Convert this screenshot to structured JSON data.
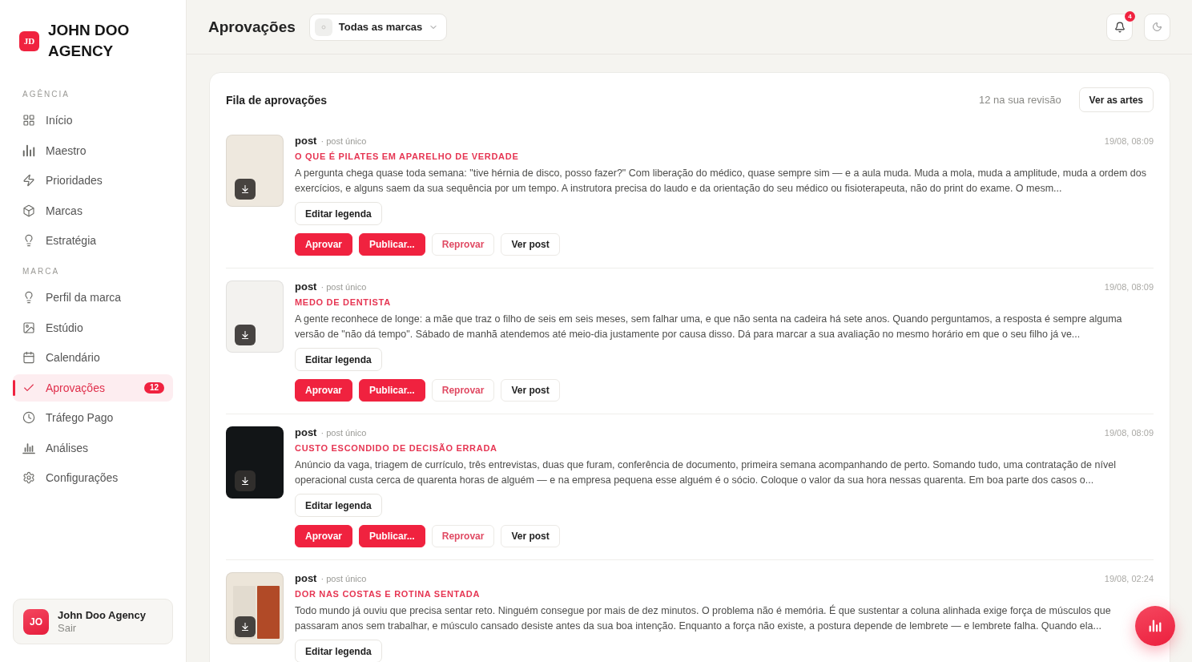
{
  "brand": {
    "logo": "JD",
    "name": "JOHN DOO AGENCY"
  },
  "sidebar": {
    "sections": [
      {
        "label": "AGÊNCIA",
        "items": [
          {
            "label": "Início",
            "selected": false
          },
          {
            "label": "Maestro",
            "selected": false
          },
          {
            "label": "Prioridades",
            "selected": false
          },
          {
            "label": "Marcas",
            "selected": false
          },
          {
            "label": "Estratégia",
            "selected": false
          }
        ]
      },
      {
        "label": "MARCA",
        "items": [
          {
            "label": "Perfil da marca",
            "selected": false
          },
          {
            "label": "Estúdio",
            "selected": false
          },
          {
            "label": "Calendário",
            "selected": false
          },
          {
            "label": "Aprovações",
            "selected": true,
            "badge": "12"
          },
          {
            "label": "Tráfego Pago",
            "selected": false
          },
          {
            "label": "Análises",
            "selected": false
          },
          {
            "label": "Configurações",
            "selected": false
          }
        ]
      }
    ]
  },
  "user": {
    "avatar": "JO",
    "name": "John Doo Agency",
    "action": "Sair"
  },
  "header": {
    "title": "Aprovações",
    "brand_filter": "Todas as marcas",
    "notifications": {
      "badge": "4"
    }
  },
  "queue": {
    "title": "Fila de aprovações",
    "count": "12 na sua revisão",
    "button": "Ver as artes",
    "posts": [
      {
        "thumbnail": {
          "kind": "plain",
          "color": "#eee8de"
        },
        "type": "post",
        "format": "· post único",
        "time": "19/08, 08:09",
        "title": "O QUE É PILATES EM APARELHO DE VERDADE",
        "text": "A pergunta chega quase toda semana: \"tive hérnia de disco, posso fazer?\" Com liberação do médico, quase sempre sim — e a aula muda. Muda a mola, muda a amplitude, muda a ordem dos exercícios, e alguns saem da sua sequência por um tempo. A instrutora precisa do laudo e da orientação do seu médico ou fisioterapeuta, não do print do exame. O mesm...",
        "edit_button": "Editar legenda",
        "actions": [
          {
            "label": "Aprovar",
            "kind": "primary"
          },
          {
            "label": "Publicar...",
            "kind": "primary"
          },
          {
            "label": "Reprovar",
            "kind": "danger"
          },
          {
            "label": "Ver post",
            "kind": "default"
          }
        ]
      },
      {
        "thumbnail": {
          "kind": "plain",
          "color": "#f3f2ef"
        },
        "type": "post",
        "format": "· post único",
        "time": "19/08, 08:09",
        "title": "MEDO DE DENTISTA",
        "text": "A gente reconhece de longe: a mãe que traz o filho de seis em seis meses, sem falhar uma, e que não senta na cadeira há sete anos. Quando perguntamos, a resposta é sempre alguma versão de \"não dá tempo\". Sábado de manhã atendemos até meio-dia justamente por causa disso. Dá para marcar a sua avaliação no mesmo horário em que o seu filho já ve...",
        "edit_button": "Editar legenda",
        "actions": [
          {
            "label": "Aprovar",
            "kind": "primary"
          },
          {
            "label": "Publicar...",
            "kind": "primary"
          },
          {
            "label": "Reprovar",
            "kind": "danger"
          },
          {
            "label": "Ver post",
            "kind": "default"
          }
        ]
      },
      {
        "thumbnail": {
          "kind": "plain",
          "color": "#121517"
        },
        "type": "post",
        "format": "· post único",
        "time": "19/08, 08:09",
        "title": "CUSTO ESCONDIDO DE DECISÃO ERRADA",
        "text": "Anúncio da vaga, triagem de currículo, três entrevistas, duas que furam, conferência de documento, primeira semana acompanhando de perto. Somando tudo, uma contratação de nível operacional custa cerca de quarenta horas de alguém — e na empresa pequena esse alguém é o sócio. Coloque o valor da sua hora nessas quarenta. Em boa parte dos casos o...",
        "edit_button": "Editar legenda",
        "actions": [
          {
            "label": "Aprovar",
            "kind": "primary"
          },
          {
            "label": "Publicar...",
            "kind": "primary"
          },
          {
            "label": "Reprovar",
            "kind": "danger"
          },
          {
            "label": "Ver post",
            "kind": "default"
          }
        ]
      },
      {
        "thumbnail": {
          "kind": "split",
          "color": "#ece5d9"
        },
        "type": "post",
        "format": "· post único",
        "time": "19/08, 02:24",
        "title": "DOR NAS COSTAS E ROTINA SENTADA",
        "text": "Todo mundo já ouviu que precisa sentar reto. Ninguém consegue por mais de dez minutos. O problema não é memória. É que sustentar a coluna alinhada exige força de músculos que passaram anos sem trabalhar, e músculo cansado desiste antes da sua boa intenção. Enquanto a força não existe, a postura depende de lembrete — e lembrete falha. Quando ela...",
        "edit_button": "Editar legenda"
      }
    ]
  }
}
